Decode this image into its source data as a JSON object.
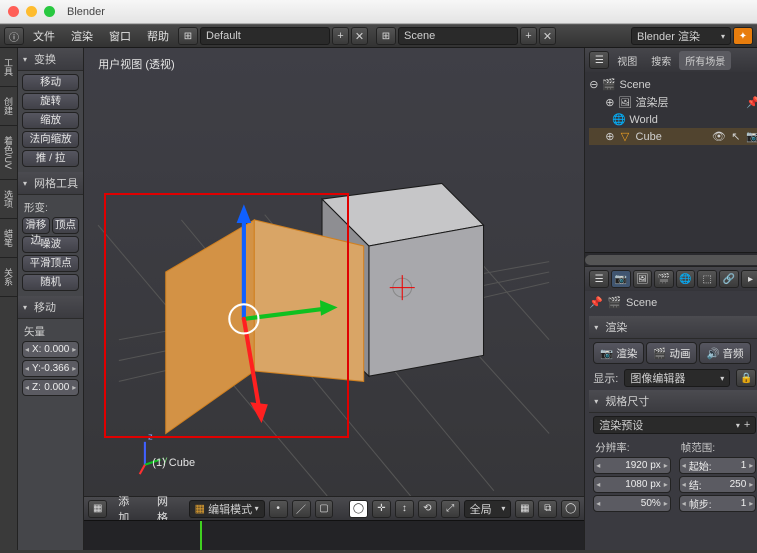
{
  "app_title": "Blender",
  "traffic_colors": {
    "close": "#ff5f57",
    "min": "#febc2e",
    "max": "#28c840"
  },
  "topmenu": {
    "file": "文件",
    "render": "渲染",
    "window": "窗口",
    "help": "帮助",
    "layout_name": "Default",
    "scene_name": "Scene",
    "engine": "Blender 渲染"
  },
  "toolshelf": {
    "tabs": [
      "工具",
      "创建",
      "着色/UV",
      "选项",
      "蜡笔",
      "关系"
    ],
    "transform": {
      "title": "变换",
      "translate": "移动",
      "rotate": "旋转",
      "scale": "缩放",
      "normal_scale": "法向缩放",
      "pushpull": "推 / 拉"
    },
    "meshtools": {
      "title": "网格工具",
      "section": "形变:",
      "edgeslide": "滑移边",
      "vert": "顶点",
      "noise": "噪波",
      "smoothvert": "平滑顶点",
      "random": "随机"
    },
    "move": {
      "title": "移动",
      "vector": "矢量",
      "x_key": "X:",
      "x_val": "0.000",
      "y_key": "Y:",
      "y_val": "-0.366",
      "z_key": "Z:",
      "z_val": "0.000"
    }
  },
  "viewport": {
    "view_name": "用户视图 (透视)",
    "object_name": "(1) Cube",
    "footer": {
      "add": "添加",
      "mesh": "网格",
      "mode": "编辑模式",
      "orient": "全局"
    }
  },
  "outliner": {
    "tabs": {
      "view": "视图",
      "search": "搜索",
      "all": "所有场景"
    },
    "scene": "Scene",
    "renderlayers": "渲染层",
    "world": "World",
    "cube": "Cube"
  },
  "props": {
    "breadcrumb": "Scene",
    "render_title": "渲染",
    "btn_render": "渲染",
    "btn_anim": "动画",
    "btn_audio": "音频",
    "display_lbl": "显示:",
    "display_val": "图像编辑器",
    "dims_title": "规格尺寸",
    "dims_preset": "渲染预设",
    "res_lbl": "分辨率:",
    "res_x": "1920 px",
    "res_y": "1080 px",
    "pct": "50%",
    "frame_lbl": "帧范围:",
    "fr_start_k": "起始:",
    "fr_start_v": "1",
    "fr_end_k": "结:",
    "fr_end_v": "250",
    "fr_step_k": "帧步:",
    "fr_step_v": "1"
  }
}
